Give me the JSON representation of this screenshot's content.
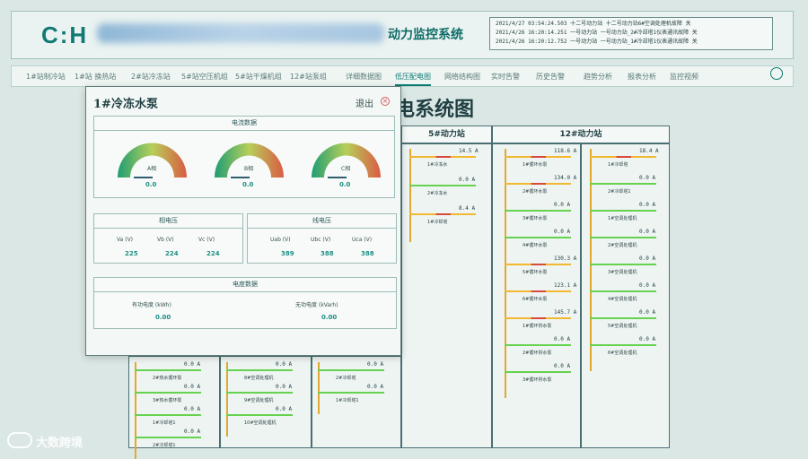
{
  "header": {
    "logo": "C:H",
    "title": "动力监控系统"
  },
  "alarms": [
    "2021/4/27 03:54:24.503 十二号动力站 十二号动力站6#空调处理机故障  关",
    "2021/4/26 16:20:14.251 一号动力站  一号动力站_2#冷却塔1仪表通讯故障 关",
    "2021/4/26 16:20:12.752 一号动力站  一号动力站_1#冷却塔1仪表通讯故障 关"
  ],
  "nav": [
    "1#站制冷站",
    "1#站 换热站",
    "2#站冷冻站",
    "5#站空压机组",
    "5#站干燥机组",
    "12#站泵组",
    "详细数据图",
    "低压配电图",
    "网络结构图",
    "实时告警",
    "历史告警",
    "趋势分析",
    "报表分析",
    "监控视频"
  ],
  "active_nav": "低压配电图",
  "diagram": {
    "title_suffix": "电系统图",
    "stations": [
      "5#动力站",
      "12#动力站"
    ]
  },
  "station5": [
    {
      "label": "1#冷冻水",
      "amp": "14.5 A"
    },
    {
      "label": "2#冷冻水",
      "amp": "0.0 A"
    },
    {
      "label": "1#冷却塔",
      "amp": "8.4 A"
    }
  ],
  "station12_left": [
    {
      "label": "1#循环水泵",
      "amp": "118.6 A"
    },
    {
      "label": "2#循环水泵",
      "amp": "134.0 A"
    },
    {
      "label": "3#循环水泵",
      "amp": "0.0 A"
    },
    {
      "label": "4#循环水泵",
      "amp": "0.0 A"
    },
    {
      "label": "5#循环水泵",
      "amp": "130.3 A"
    },
    {
      "label": "6#循环水泵",
      "amp": "123.1 A"
    },
    {
      "label": "1#循环供水泵",
      "amp": "145.7 A"
    },
    {
      "label": "2#循环供水泵",
      "amp": "0.0 A"
    },
    {
      "label": "3#循环供水泵",
      "amp": "0.0 A"
    }
  ],
  "station12_right": [
    {
      "label": "1#冷却塔",
      "amp": "18.4 A"
    },
    {
      "label": "2#冷却塔1",
      "amp": "0.0 A"
    },
    {
      "label": "1#空调处理机",
      "amp": "0.0 A"
    },
    {
      "label": "2#空调处理机",
      "amp": "0.0 A"
    },
    {
      "label": "3#空调处理机",
      "amp": "0.0 A"
    },
    {
      "label": "4#空调处理机",
      "amp": "0.0 A"
    },
    {
      "label": "5#空调处理机",
      "amp": "0.0 A"
    },
    {
      "label": "6#空调处理机",
      "amp": "0.0 A"
    }
  ],
  "bottom_col1": [
    {
      "label": "2#热水循环泵",
      "amp": "0.0 A"
    },
    {
      "label": "3#热水循环泵",
      "amp": "0.0 A"
    },
    {
      "label": "1#冷却塔1",
      "amp": "0.0 A"
    },
    {
      "label": "2#冷却塔1",
      "amp": "0.0 A"
    }
  ],
  "bottom_col2": [
    {
      "label": "8#空调处理机",
      "amp": "0.0 A"
    },
    {
      "label": "9#空调处理机",
      "amp": "0.0 A"
    },
    {
      "label": "10#空调处理机",
      "amp": "0.0 A"
    }
  ],
  "bottom_col3": [
    {
      "label": "2#冷却塔",
      "amp": "0.0 A"
    },
    {
      "label": "1#冷却塔1",
      "amp": "0.0 A"
    }
  ],
  "modal": {
    "title": "1#冷冻水泵",
    "quit": "退出",
    "current_title": "电流数据",
    "phases": [
      {
        "name": "A相",
        "value": "0.0"
      },
      {
        "name": "B相",
        "value": "0.0"
      },
      {
        "name": "C相",
        "value": "0.0"
      }
    ],
    "phase_voltage_title": "相电压",
    "phase_voltage": [
      {
        "name": "Va (V)",
        "value": "225"
      },
      {
        "name": "Vb (V)",
        "value": "224"
      },
      {
        "name": "Vc (V)",
        "value": "224"
      }
    ],
    "line_voltage_title": "线电压",
    "line_voltage": [
      {
        "name": "Uab (V)",
        "value": "389"
      },
      {
        "name": "Ubc (V)",
        "value": "388"
      },
      {
        "name": "Uca (V)",
        "value": "388"
      }
    ],
    "energy_title": "电度数据",
    "energy": [
      {
        "name": "有功电度 (kWh)",
        "value": "0.00"
      },
      {
        "name": "无功电度 (kVarh)",
        "value": "0.00"
      }
    ]
  },
  "watermark": "大数跨境"
}
